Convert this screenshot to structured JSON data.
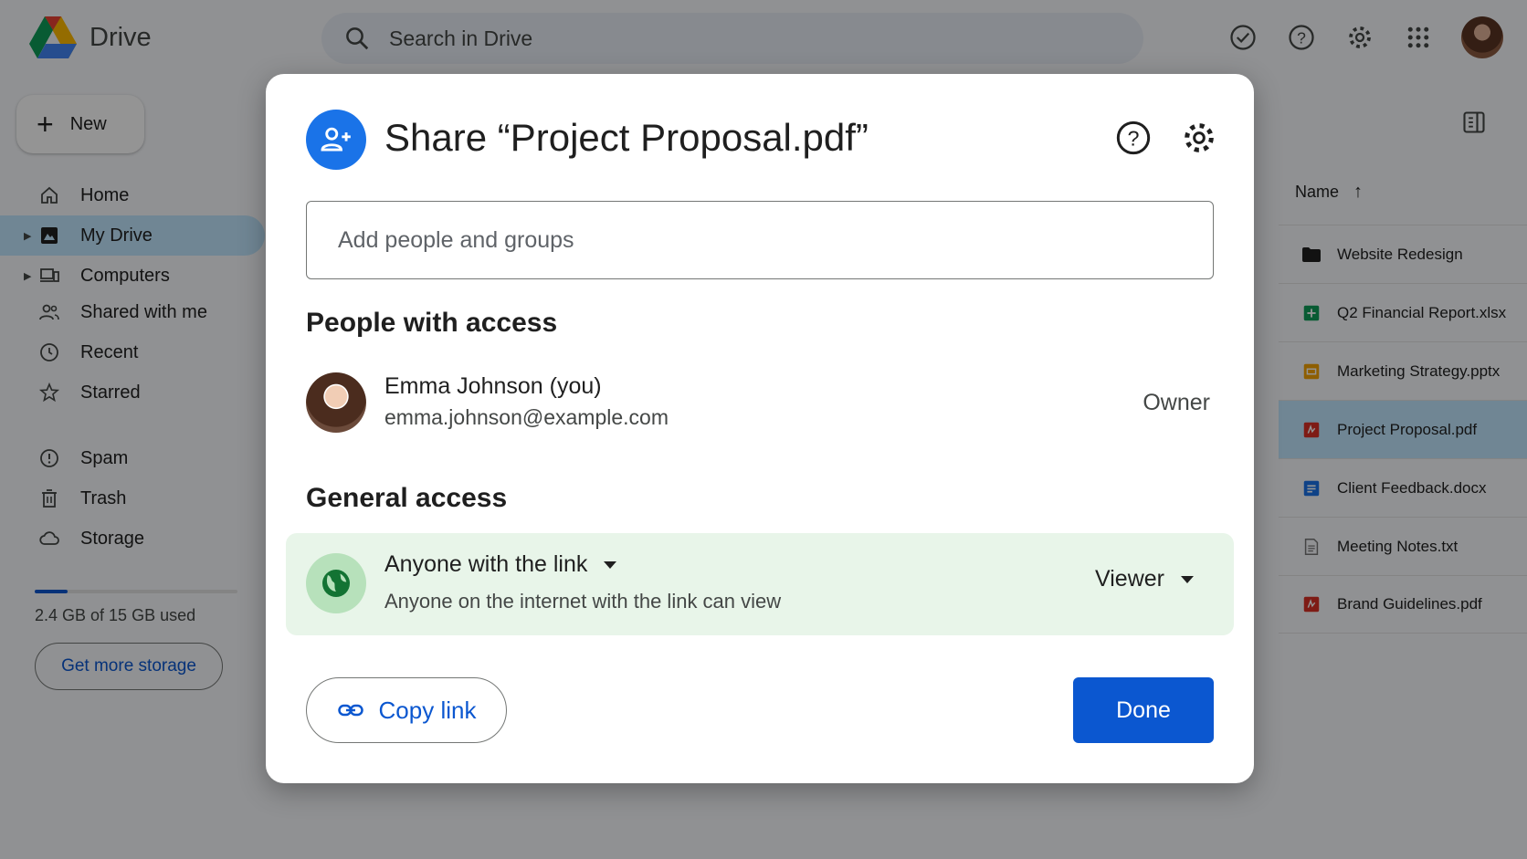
{
  "app": {
    "name": "Drive"
  },
  "search": {
    "placeholder": "Search in Drive"
  },
  "sidebar": {
    "new_label": "New",
    "items": [
      {
        "label": "Home"
      },
      {
        "label": "My Drive"
      },
      {
        "label": "Computers"
      },
      {
        "label": "Shared with me"
      },
      {
        "label": "Recent"
      },
      {
        "label": "Starred"
      },
      {
        "label": "Spam"
      },
      {
        "label": "Trash"
      },
      {
        "label": "Storage"
      }
    ],
    "storage_used_fraction": 0.16,
    "storage_text": "2.4 GB of 15 GB used",
    "get_storage_label": "Get more storage"
  },
  "file_list": {
    "name_header": "Name",
    "files": [
      {
        "name": "Website Redesign",
        "icon": "folder-icon"
      },
      {
        "name": "Q2 Financial Report.xlsx",
        "icon": "sheets-icon"
      },
      {
        "name": "Marketing Strategy.pptx",
        "icon": "slides-icon"
      },
      {
        "name": "Project Proposal.pdf",
        "icon": "pdf-icon"
      },
      {
        "name": "Client Feedback.docx",
        "icon": "docs-icon"
      },
      {
        "name": "Meeting Notes.txt",
        "icon": "text-file-icon"
      },
      {
        "name": "Brand Guidelines.pdf",
        "icon": "pdf-icon"
      }
    ]
  },
  "dialog": {
    "title": "Share “Project Proposal.pdf”",
    "add_placeholder": "Add people and groups",
    "people_heading": "People with access",
    "person": {
      "name": "Emma Johnson (you)",
      "email": "emma.johnson@example.com",
      "role": "Owner"
    },
    "general_heading": "General access",
    "access": {
      "type": "Anyone with the link",
      "description": "Anyone on the internet with the link can view",
      "role": "Viewer"
    },
    "copy_link_label": "Copy link",
    "done_label": "Done"
  },
  "colors": {
    "primary": "#0b57d0",
    "dialog_badge": "#1a73e8",
    "access_bg": "#e8f5e9",
    "globe_bg": "#b7e1bb",
    "selected_bg": "#c2e7ff"
  }
}
